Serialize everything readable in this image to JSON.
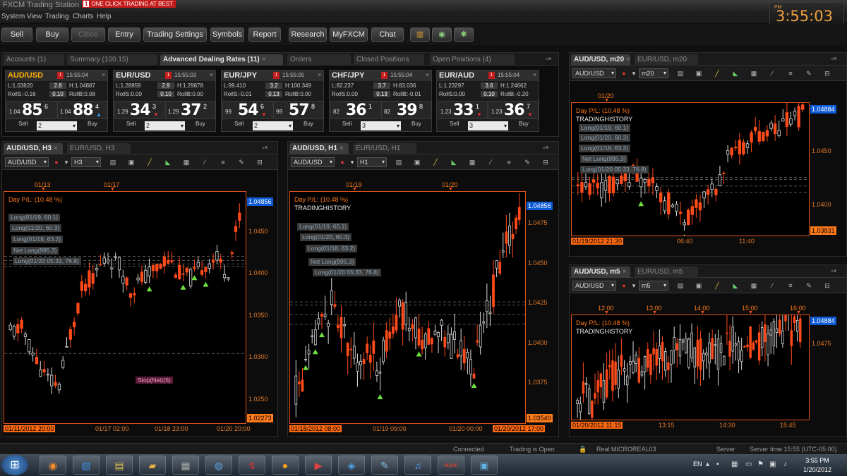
{
  "app": {
    "title": "FXCM Trading Station",
    "oneclick_num": "1",
    "oneclick": "ONE CLICK TRADING AT BEST"
  },
  "menu": [
    "System",
    "View",
    "Trading",
    "Charts",
    "Help"
  ],
  "clock": {
    "pm": "PM",
    "time": "3:55:03"
  },
  "toolbar": {
    "buttons": [
      "Sell",
      "Buy",
      "Close",
      "Entry",
      "Trading Settings",
      "Symbols",
      "Report",
      "Research",
      "MyFXCM",
      "Chat"
    ],
    "icons": [
      "chart-bars-icon",
      "globe-icon",
      "gear-icon"
    ]
  },
  "top_tabs": [
    "Accounts (1)",
    "Summary (100.15)",
    "Advanced Dealing Rates (11)",
    "Orders",
    "Closed Positions",
    "Open Positions (4)"
  ],
  "rates": [
    {
      "symbol": "AUD/USD",
      "time": "15:55:04",
      "low": "L:1.03820",
      "spread": "2.8",
      "high": "H:1.04887",
      "rs": "RollS:-0.16",
      "rsv": "0.10",
      "rb": "RollB:0.08",
      "sell_pre": "1.04",
      "sell_big": "85",
      "sell_sup": "6",
      "buy_pre": "1.04",
      "buy_big": "88",
      "buy_sup": "4",
      "buy_dir": "up",
      "amount": "2",
      "sell": "Sell",
      "buy": "Buy"
    },
    {
      "symbol": "EUR/USD",
      "time": "15:55:03",
      "low": "L:1.28859",
      "spread": "2.9",
      "high": "H:1.29878",
      "rs": "RollS:0.00",
      "rsv": "0.10",
      "rb": "RollB:0.00",
      "sell_pre": "1.29",
      "sell_big": "34",
      "sell_sup": "3",
      "buy_pre": "1.29",
      "buy_big": "37",
      "buy_sup": "2",
      "sell_dir": "down",
      "amount": "2",
      "sell": "Sell",
      "buy": "Buy"
    },
    {
      "symbol": "EUR/JPY",
      "time": "15:55:05",
      "low": "L:99.410",
      "spread": "3.2",
      "high": "H:100.349",
      "rs": "RollS:-0.01",
      "rsv": "0.13",
      "rb": "RollB:0.00",
      "sell_pre": "99",
      "sell_big": "54",
      "sell_sup": "6",
      "buy_pre": "99",
      "buy_big": "57",
      "buy_sup": "8",
      "sell_dir": "down",
      "amount": "2",
      "sell": "Sell",
      "buy": "Buy"
    },
    {
      "symbol": "CHF/JPY",
      "time": "15:55:04",
      "low": "L:82.237",
      "spread": "3.7",
      "high": "H:83.036",
      "rs": "RollS:0.00",
      "rsv": "0.13",
      "rb": "RollB:-0.01",
      "sell_pre": "82",
      "sell_big": "36",
      "sell_sup": "1",
      "buy_pre": "82",
      "buy_big": "39",
      "buy_sup": "8",
      "amount": "3",
      "sell": "Sell",
      "buy": "Buy"
    },
    {
      "symbol": "EUR/AUD",
      "time": "15:55:04",
      "low": "L:1.23297",
      "spread": "3.6",
      "high": "H:1.24662",
      "rs": "RollS:0.00",
      "rsv": "0.10",
      "rb": "RollB:-0.20",
      "sell_pre": "1.23",
      "sell_big": "33",
      "sell_sup": "1",
      "buy_pre": "1.23",
      "buy_big": "36",
      "buy_sup": "7",
      "sell_dir": "down",
      "buy_dir": "down",
      "amount": "3",
      "sell": "Sell",
      "buy": "Buy"
    }
  ],
  "common": {
    "dpl": "Day P/L: (10.48 %)",
    "tdh": "TRADINGHISTORY",
    "trades": [
      "Long(01/19, 60.1)",
      "Long(01/20, 60.3)",
      "Long(01/18, 63.2)",
      "Net Long(995.3)",
      "Long(01/20 05:33, 76.8)"
    ],
    "stop": "Stop(Net)(5)"
  },
  "charts": {
    "h3": {
      "tab": "AUD/USD, H3",
      "tab2": "EUR/USD, H3",
      "sym": "AUD/USD",
      "tf": "H3",
      "dates": [
        "01/13",
        "01/17"
      ],
      "price": "1.04856",
      "low": "1.02273",
      "yticks": [
        "1.0450",
        "1.0400",
        "1.0350",
        "1.0300",
        "1.0250"
      ],
      "xs": "01/11/2012 20:00",
      "xlabels": [
        "01/17 02:00",
        "01/18 23:00",
        "01/20 20:00"
      ]
    },
    "h1": {
      "tab": "AUD/USD, H1",
      "tab2": "EUR/USD, H1",
      "sym": "AUD/USD",
      "tf": "H1",
      "dates": [
        "01/19",
        "01/20"
      ],
      "price": "1.04856",
      "low": "1.03540",
      "yticks": [
        "1.0475",
        "1.0450",
        "1.0425",
        "1.0400",
        "1.0375"
      ],
      "xs": "01/18/2012 08:00",
      "xlabels": [
        "01/19 09:00",
        "01/20 00:00"
      ],
      "xe": "01/20/2012 17:00"
    },
    "m20": {
      "tab": "AUD/USD, m20",
      "tab2": "EUR/USD, m20",
      "sym": "AUD/USD",
      "tf": "m20",
      "dates": [
        "01/20"
      ],
      "price": "1.04884",
      "low": "1.03831",
      "yticks": [
        "1.0450",
        "1.0400"
      ],
      "xs": "01/19/2012 21:20",
      "xlabels": [
        "06:40",
        "11:40"
      ]
    },
    "m5": {
      "tab": "AUD/USD, m5",
      "tab2": "EUR/USD, m5",
      "sym": "AUD/USD",
      "tf": "m5",
      "dates": [
        "12:00",
        "13:00",
        "14:00",
        "15:00",
        "16:00"
      ],
      "price": "1.04884",
      "yticks": [
        "1.0475"
      ],
      "xs": "01/20/2012 11:15",
      "xlabels": [
        "13:15",
        "14:30",
        "15:45"
      ]
    }
  },
  "status": {
    "connected": "Connected",
    "trading": "Trading is Open",
    "real": "Real:MICROREAL03",
    "server": "Server",
    "server_time": "Server time 15:55 (UTC-05:00)"
  },
  "taskbar": {
    "apps": [
      "firefox-icon",
      "teamviewer-icon",
      "explorer-icon",
      "folder-icon",
      "calculator-icon",
      "mediaplayer-icon",
      "flashget-icon",
      "orange-icon",
      "media-icon",
      "thunderbird-icon",
      "paint-icon",
      "itunes-icon",
      "alpari-icon",
      "trading-icon"
    ],
    "alpari": "alpari",
    "lang": "EN",
    "time": "3:55 PM",
    "date": "1/20/2012"
  }
}
